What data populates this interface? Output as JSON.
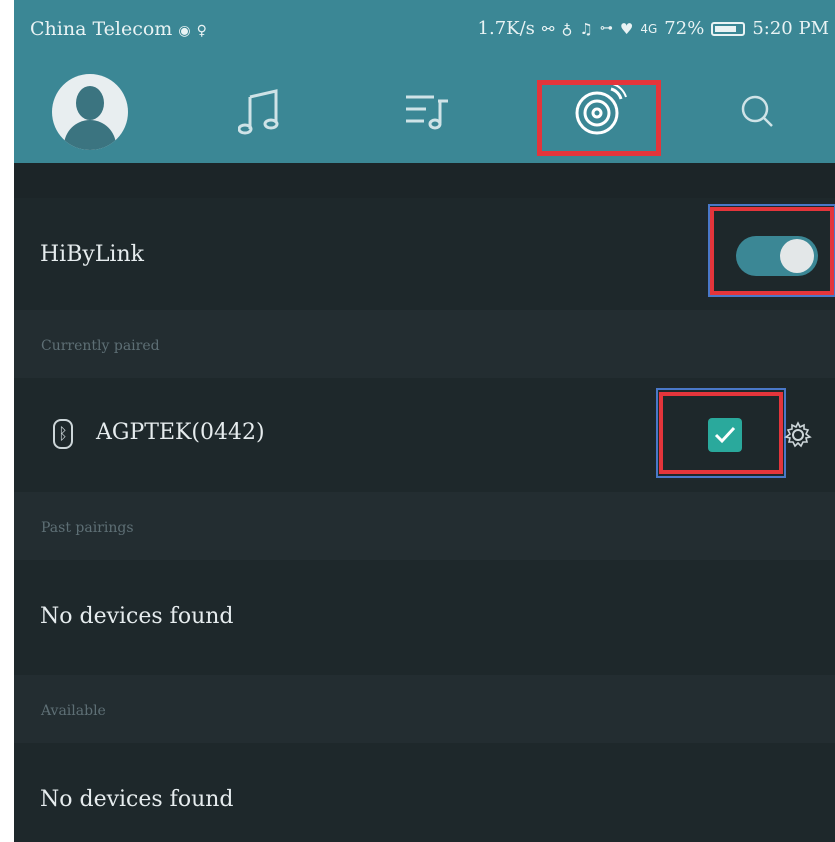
{
  "status_bar": {
    "carrier": "China Telecom",
    "network_speed": "1.7K/s",
    "network_type": "4G",
    "battery": "72%",
    "time": "5:20 PM"
  },
  "nav": {
    "items": [
      "avatar",
      "music-note-icon",
      "playlist-icon",
      "hibylink-icon",
      "search-icon"
    ],
    "active": "hibylink-icon"
  },
  "hibylink": {
    "label": "HiByLink",
    "enabled": true
  },
  "sections": {
    "currently_paired": "Currently paired",
    "past_pairings": "Past pairings",
    "available": "Available"
  },
  "paired_device": {
    "name": "AGPTEK(0442)",
    "checked": true
  },
  "past_pairings_empty": "No devices found",
  "available_empty": "No devices found",
  "colors": {
    "accent": "#3b8795",
    "background": "#1c2528",
    "checkbox": "#2aa99c",
    "highlight": "#e4353b"
  }
}
